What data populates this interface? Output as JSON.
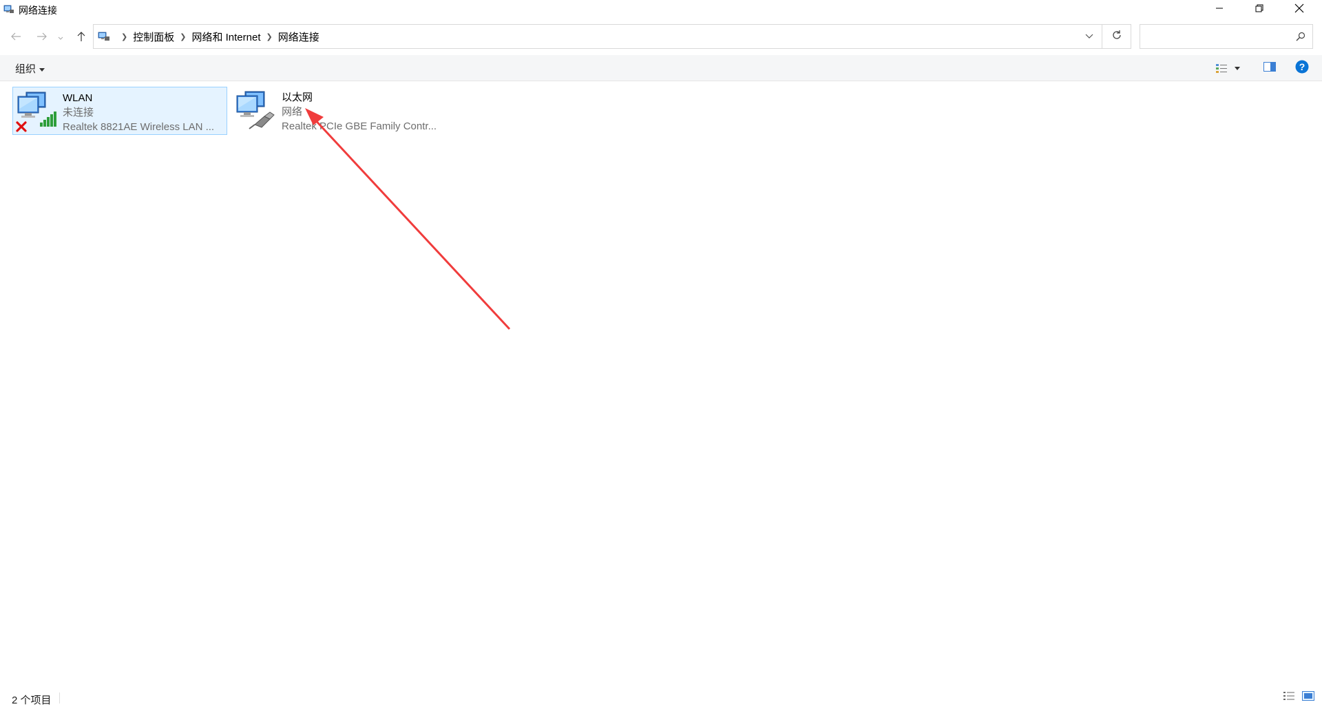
{
  "window": {
    "title": "网络连接",
    "minimize_icon": "minimize-icon",
    "maximize_icon": "restore-icon",
    "close_icon": "close-icon"
  },
  "navigation": {
    "back_icon": "arrow-left-icon",
    "forward_icon": "arrow-right-icon",
    "recent_icon": "chevron-down-icon",
    "up_icon": "arrow-up-icon"
  },
  "address": {
    "breadcrumbs": [
      "控制面板",
      "网络和 Internet",
      "网络连接"
    ],
    "dropdown_icon": "chevron-down-icon",
    "refresh_icon": "refresh-icon"
  },
  "search": {
    "value": "",
    "placeholder": "",
    "icon": "search-icon"
  },
  "commandbar": {
    "organize_label": "组织",
    "view_options_icon": "view-options-icon",
    "preview_pane_icon": "preview-pane-icon",
    "help_icon": "help-icon"
  },
  "connections": [
    {
      "name": "WLAN",
      "status": "未连接",
      "device": "Realtek 8821AE Wireless LAN ...",
      "type": "wireless",
      "disconnected": true,
      "selected": true
    },
    {
      "name": "以太网",
      "status": "网络",
      "device": "Realtek PCIe GBE Family Contr...",
      "type": "ethernet",
      "disconnected": false,
      "selected": false
    }
  ],
  "statusbar": {
    "item_count": "2 个项目",
    "details_view_icon": "details-view-icon",
    "large_icons_view_icon": "large-icons-view-icon"
  },
  "colors": {
    "selection_bg": "#e5f3ff",
    "selection_border": "#99d1ff",
    "annotation_arrow": "#f03c3c",
    "help_blue": "#0a74d6"
  }
}
